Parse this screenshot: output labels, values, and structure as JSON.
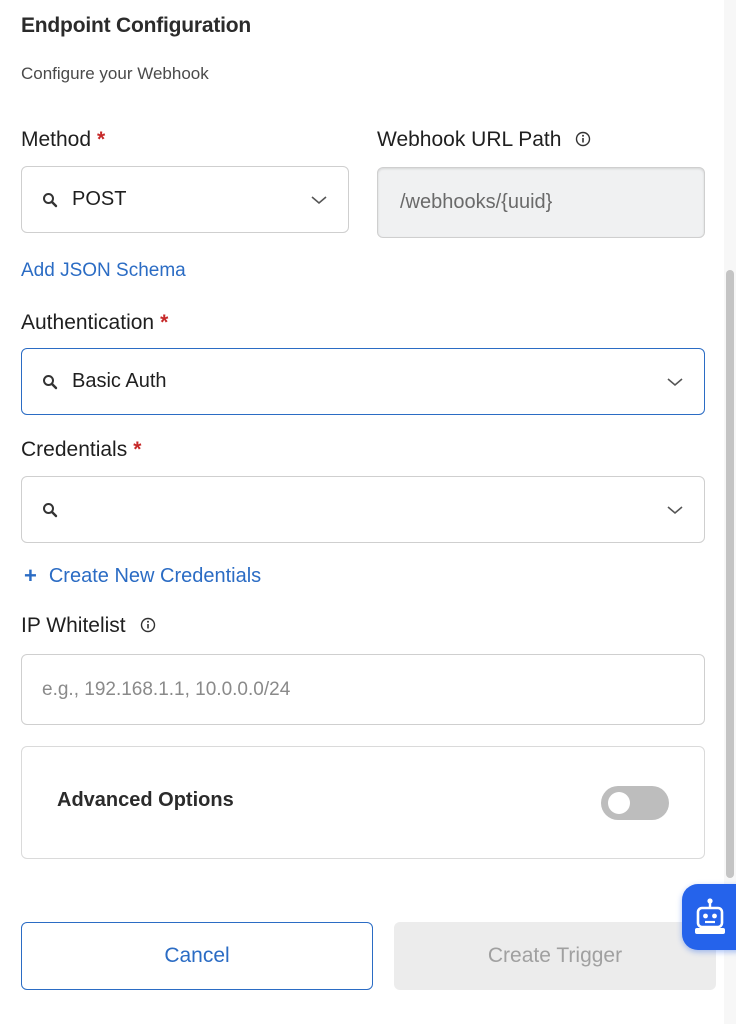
{
  "section": {
    "title": "Endpoint Configuration",
    "subtitle": "Configure your Webhook"
  },
  "method": {
    "label": "Method",
    "required_mark": "*",
    "value": "POST"
  },
  "webhook_path": {
    "label": "Webhook URL Path",
    "value": "/webhooks/{uuid}"
  },
  "schema_link": "Add JSON Schema",
  "authentication": {
    "label": "Authentication",
    "required_mark": "*",
    "value": "Basic Auth"
  },
  "credentials": {
    "label": "Credentials",
    "required_mark": "*",
    "value": "",
    "create_link": "Create New Credentials",
    "create_plus": "+"
  },
  "ip_whitelist": {
    "label": "IP Whitelist",
    "placeholder": "e.g., 192.168.1.1, 10.0.0.0/24"
  },
  "advanced": {
    "title": "Advanced Options",
    "enabled": false
  },
  "actions": {
    "cancel_label": "Cancel",
    "create_label": "Create Trigger"
  },
  "colors": {
    "accent": "#2b6cc4",
    "required": "#c62828",
    "assistant": "#2563eb"
  },
  "icons": [
    "search-icon",
    "chevron-down-icon",
    "info-icon",
    "robot-icon"
  ]
}
